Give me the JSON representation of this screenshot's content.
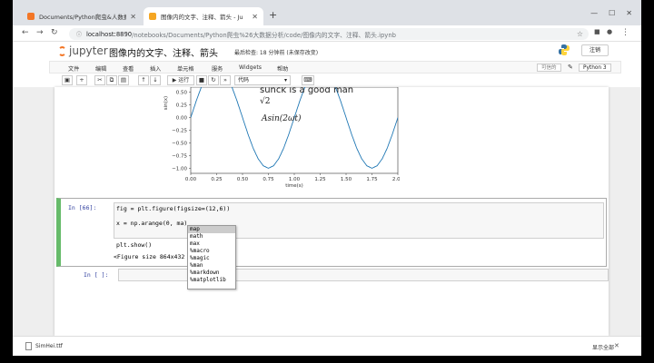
{
  "browser": {
    "tabs": [
      {
        "title": "Documents/Python爬虫&人数据…",
        "active": false
      },
      {
        "title": "图像内的文字、注释、箭头 - Ju",
        "active": true
      }
    ],
    "address": {
      "host": "localhost:8890",
      "path": "/notebooks/Documents/Python爬虫%26大数据分析/code/图像内的文字、注释、箭头.ipynb"
    }
  },
  "jupyter": {
    "logo_text": "jupyter",
    "notebook_title": "图像内的文字、注释、箭头",
    "checkpoint": "最后检查: 18 分钟前   (未保存改变)",
    "logout_label": "注销",
    "menus": [
      "文件",
      "编辑",
      "查看",
      "插入",
      "单元格",
      "服务",
      "Widgets",
      "帮助"
    ],
    "trusted_label": "可信的",
    "kernel_label": "Python 3",
    "toolbar": {
      "run_label": "运行",
      "cell_type": "代码"
    }
  },
  "plot": {
    "annotation_text": "sunck is a good man",
    "sqrt_text": "√2",
    "formula_text": "𝐴sin(2𝜔𝑡)",
    "ylabel": "sin(x)",
    "xlabel": "time(s)",
    "x_ticks": [
      "0.00",
      "0.25",
      "0.50",
      "0.75",
      "1.00",
      "1.25",
      "1.50",
      "1.75",
      "2.00"
    ],
    "y_ticks": [
      "0.50",
      "0.25",
      "0.00",
      "−0.25",
      "−0.50",
      "−0.75",
      "−1.00"
    ]
  },
  "chart_data": {
    "type": "line",
    "xlabel": "time(s)",
    "ylabel": "sin(x)",
    "xlim": [
      0,
      2
    ],
    "ylim": [
      -1.1,
      0.6
    ],
    "series": [
      {
        "x": [
          0,
          0.05,
          0.1,
          0.15,
          0.2,
          0.25,
          0.3,
          0.35,
          0.4,
          0.45,
          0.5,
          0.55,
          0.6,
          0.65,
          0.7,
          0.75,
          0.8,
          0.85,
          0.9,
          0.95,
          1.0,
          1.05,
          1.1,
          1.15,
          1.2,
          1.25,
          1.3,
          1.35,
          1.4,
          1.45,
          1.5,
          1.55,
          1.6,
          1.65,
          1.7,
          1.75,
          1.8,
          1.85,
          1.9,
          1.95,
          2.0
        ],
        "y": [
          0,
          0.31,
          0.59,
          0.81,
          0.95,
          1.0,
          0.95,
          0.81,
          0.59,
          0.31,
          0,
          -0.31,
          -0.59,
          -0.81,
          -0.95,
          -1.0,
          -0.95,
          -0.81,
          -0.59,
          -0.31,
          0,
          0.31,
          0.59,
          0.81,
          0.95,
          1.0,
          0.95,
          0.81,
          0.59,
          0.31,
          0,
          -0.31,
          -0.59,
          -0.81,
          -0.95,
          -1.0,
          -0.95,
          -0.81,
          -0.59,
          -0.31,
          0
        ]
      }
    ],
    "colors": {
      "line": "#1f77b4"
    }
  },
  "cells": {
    "active_prompt": "In [66]:",
    "code_lines": [
      "fig = plt.figure(figsize=(12,6))",
      "",
      "x = np.arange(0, ma)",
      "",
      "plt.show()"
    ],
    "output_text": "<Figure size 864x432 with 0 Axes>",
    "empty_prompt": "In [ ]:"
  },
  "autocomplete": {
    "items": [
      "map",
      "math",
      "max",
      "%macro",
      "%magic",
      "%man",
      "%markdown",
      "%matplotlib"
    ],
    "selected_index": 0
  },
  "download_bar": {
    "file_label": "SimHei.ttf",
    "show_all": "显示全部",
    "close": "✕"
  }
}
